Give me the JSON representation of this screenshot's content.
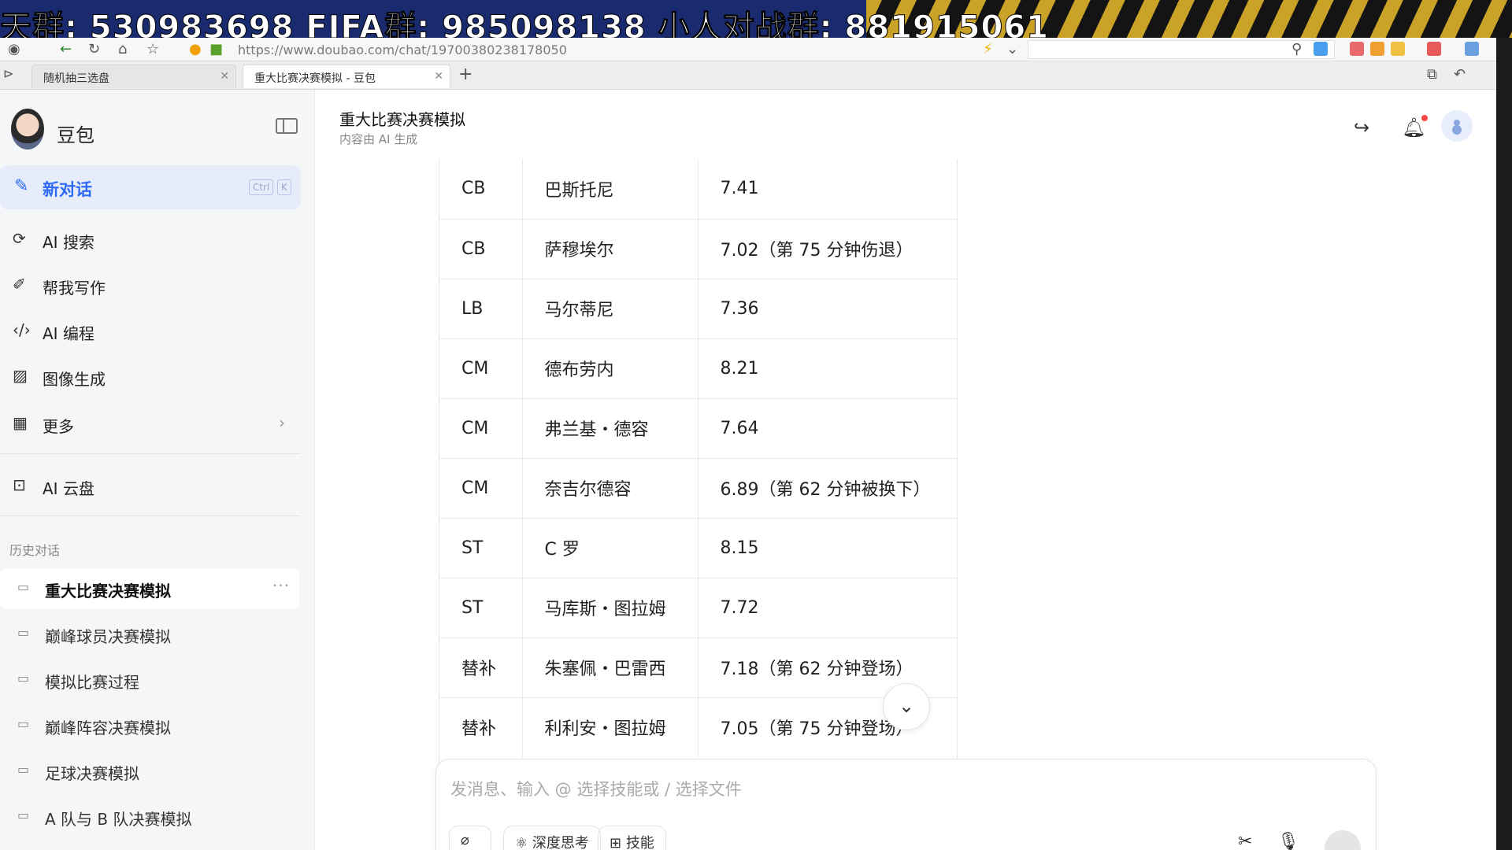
{
  "overlay_banner": {
    "text": "天群: 530983698   FIFA群: 985098138   小人对战群: 881915061"
  },
  "browser": {
    "url": "https://www.doubao.com/chat/19700380238178050",
    "tabs": [
      {
        "label": "随机抽三选盘"
      },
      {
        "label": "重大比赛决赛模拟 - 豆包"
      }
    ],
    "new_tab": "+"
  },
  "sidebar": {
    "brand": "豆包",
    "new_chat": {
      "label": "新对话",
      "shortcut_1": "Ctrl",
      "shortcut_2": "K"
    },
    "nav": [
      {
        "label": "AI 搜索",
        "icon": "search-icon"
      },
      {
        "label": "帮我写作",
        "icon": "pen-icon"
      },
      {
        "label": "AI 编程",
        "icon": "code-icon"
      },
      {
        "label": "图像生成",
        "icon": "image-icon"
      },
      {
        "label": "更多",
        "icon": "grid-icon"
      }
    ],
    "cloud": {
      "label": "AI 云盘"
    },
    "history_title": "历史对话",
    "history": [
      {
        "label": "重大比赛决赛模拟"
      },
      {
        "label": "巅峰球员决赛模拟"
      },
      {
        "label": "模拟比赛过程"
      },
      {
        "label": "巅峰阵容决赛模拟"
      },
      {
        "label": "足球决赛模拟"
      },
      {
        "label": "A 队与 B 队决赛模拟"
      }
    ]
  },
  "main": {
    "title": "重大比赛决赛模拟",
    "subtitle": "内容由 AI 生成",
    "table_rows": [
      [
        "CB",
        "巴斯托尼",
        "7.41"
      ],
      [
        "CB",
        "萨穆埃尔",
        "7.02（第 75 分钟伤退）"
      ],
      [
        "LB",
        "马尔蒂尼",
        "7.36"
      ],
      [
        "CM",
        "德布劳内",
        "8.21"
      ],
      [
        "CM",
        "弗兰基・德容",
        "7.64"
      ],
      [
        "CM",
        "奈吉尔德容",
        "6.89（第 62 分钟被换下）"
      ],
      [
        "ST",
        "C 罗",
        "8.15"
      ],
      [
        "ST",
        "马库斯・图拉姆",
        "7.72"
      ],
      [
        "替补",
        "朱塞佩・巴雷西",
        "7.18（第 62 分钟登场）"
      ],
      [
        "替补",
        "利利安・图拉姆",
        "7.05（第 75 分钟登场）"
      ]
    ],
    "composer": {
      "placeholder": "发消息、输入 @ 选择技能或 / 选择文件",
      "deep_think": "深度思考",
      "skills": "技能"
    }
  },
  "colors": {
    "accent": "#2f6bf5",
    "banner": "#1a2a6e"
  }
}
